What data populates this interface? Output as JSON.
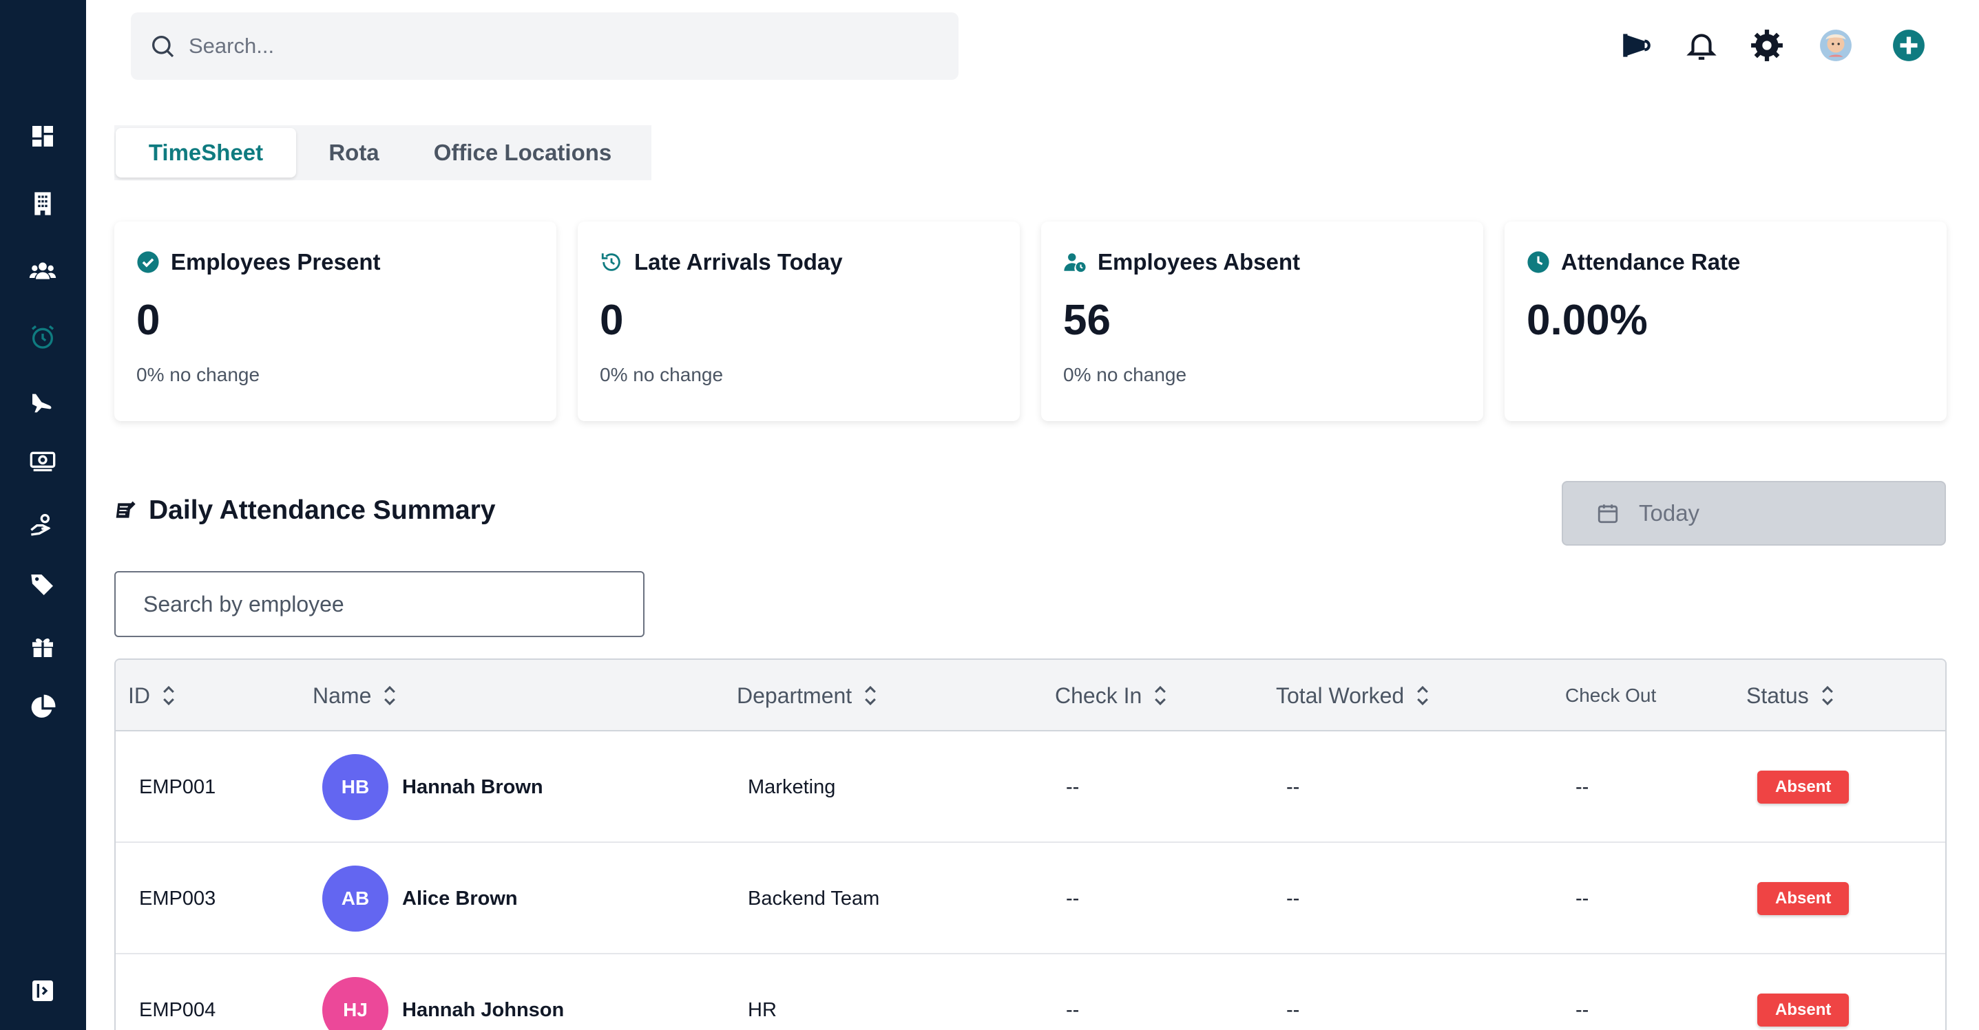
{
  "search": {
    "placeholder": "Search..."
  },
  "tabs": [
    {
      "label": "TimeSheet",
      "active": true
    },
    {
      "label": "Rota",
      "active": false
    },
    {
      "label": "Office Locations",
      "active": false
    }
  ],
  "stats": [
    {
      "title": "Employees Present",
      "value": "0",
      "sub": "0% no change",
      "icon": "check-circle-icon"
    },
    {
      "title": "Late Arrivals Today",
      "value": "0",
      "sub": "0% no change",
      "icon": "clock-rotate-icon"
    },
    {
      "title": "Employees Absent",
      "value": "56",
      "sub": "0% no change",
      "icon": "user-clock-icon"
    },
    {
      "title": "Attendance Rate",
      "value": "0.00%",
      "sub": "",
      "icon": "clock-icon"
    }
  ],
  "summary": {
    "title": "Daily Attendance Summary",
    "date_label": "Today",
    "employee_search_placeholder": "Search by employee"
  },
  "table": {
    "columns": [
      "ID",
      "Name",
      "Department",
      "Check In",
      "Total Worked",
      "Check Out",
      "Status"
    ],
    "rows": [
      {
        "id": "EMP001",
        "initials": "HB",
        "name": "Hannah Brown",
        "department": "Marketing",
        "check_in": "--",
        "total_worked": "--",
        "check_out": "--",
        "status": "Absent",
        "avatar_color": "#6366f1"
      },
      {
        "id": "EMP003",
        "initials": "AB",
        "name": "Alice Brown",
        "department": "Backend Team",
        "check_in": "--",
        "total_worked": "--",
        "check_out": "--",
        "status": "Absent",
        "avatar_color": "#6366f1"
      },
      {
        "id": "EMP004",
        "initials": "HJ",
        "name": "Hannah Johnson",
        "department": "HR",
        "check_in": "--",
        "total_worked": "--",
        "check_out": "--",
        "status": "Absent",
        "avatar_color": "#ec4899"
      }
    ]
  },
  "colors": {
    "sidebar": "#0b1f38",
    "accent": "#0f7b80",
    "absent": "#ef4444"
  }
}
